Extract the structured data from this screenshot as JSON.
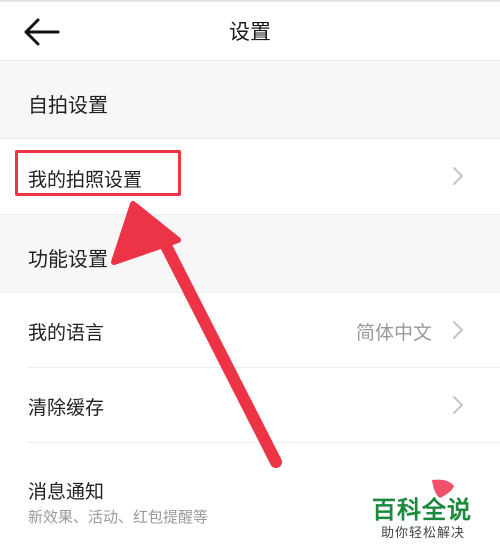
{
  "header": {
    "title": "设置",
    "back_icon": "back-arrow-icon"
  },
  "sections": {
    "selfie": {
      "label": "自拍设置"
    },
    "function": {
      "label": "功能设置"
    }
  },
  "rows": {
    "my_photo": {
      "label": "我的拍照设置"
    },
    "language": {
      "label": "我的语言",
      "value": "简体中文"
    },
    "clear_cache": {
      "label": "清除缓存"
    },
    "notifications": {
      "label": "消息通知",
      "subtitle": "新效果、活动、红包提醒等"
    }
  },
  "annotation": {
    "color": "#ec3446"
  },
  "watermark": {
    "title": "百科全说",
    "subtitle": "助你轻松解决",
    "color": "#1b8a3e"
  }
}
